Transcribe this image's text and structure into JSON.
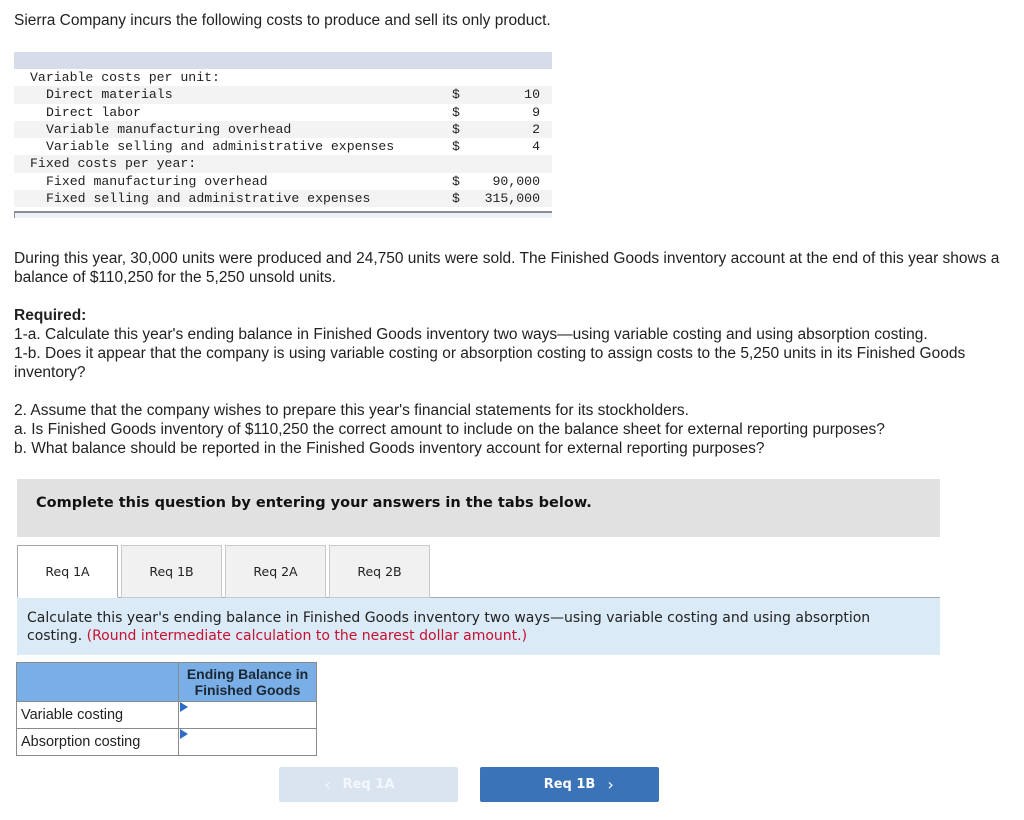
{
  "intro": "Sierra Company incurs the following costs to produce and sell its only product.",
  "cost_table": {
    "rows": [
      {
        "label": "Variable costs per unit:",
        "level": 0,
        "dollar": "",
        "amount": ""
      },
      {
        "label": "Direct materials",
        "level": 1,
        "dollar": "$",
        "amount": "10"
      },
      {
        "label": "Direct labor",
        "level": 1,
        "dollar": "$",
        "amount": "9"
      },
      {
        "label": "Variable manufacturing overhead",
        "level": 1,
        "dollar": "$",
        "amount": "2"
      },
      {
        "label": "Variable selling and administrative expenses",
        "level": 1,
        "dollar": "$",
        "amount": "4"
      },
      {
        "label": "Fixed costs per year:",
        "level": 0,
        "dollar": "",
        "amount": ""
      },
      {
        "label": "Fixed manufacturing overhead",
        "level": 1,
        "dollar": "$",
        "amount": "90,000"
      },
      {
        "label": "Fixed selling and administrative expenses",
        "level": 1,
        "dollar": "$",
        "amount": "315,000"
      }
    ]
  },
  "paragraph1": "During this year, 30,000 units were produced and 24,750 units were sold. The Finished Goods inventory account at the end of this year shows a balance of $110,250 for the 5,250 unsold units.",
  "required": {
    "heading": "Required:",
    "items": [
      "1-a. Calculate this year's ending balance in Finished Goods inventory two ways—using variable costing and using absorption costing.",
      "1-b. Does it appear that the company is using variable costing or absorption costing to assign costs to the 5,250 units in its Finished Goods inventory?"
    ]
  },
  "part2": [
    "2. Assume that the company wishes to prepare this year's financial statements for its stockholders.",
    "a. Is Finished Goods inventory of $110,250 the correct amount to include on the balance sheet for external reporting purposes?",
    "b. What balance should be reported in the Finished Goods inventory account for external reporting purposes?"
  ],
  "banner": "Complete this question by entering your answers in the tabs below.",
  "tabs": [
    {
      "label": "Req 1A",
      "active": true
    },
    {
      "label": "Req 1B",
      "active": false
    },
    {
      "label": "Req 2A",
      "active": false
    },
    {
      "label": "Req 2B",
      "active": false
    }
  ],
  "instruction": {
    "text": "Calculate this year's ending balance in Finished Goods inventory two ways—using variable costing and using absorption costing.",
    "note": "(Round intermediate calculation to the nearest dollar amount.)"
  },
  "answer_table": {
    "column_header": "Ending Balance in Finished Goods",
    "rows": [
      {
        "label": "Variable costing",
        "value": ""
      },
      {
        "label": "Absorption costing",
        "value": ""
      }
    ]
  },
  "nav": {
    "prev_label": "Req 1A",
    "next_label": "Req 1B",
    "prev_icon": "chevron-left-icon",
    "next_icon": "chevron-right-icon"
  },
  "colors": {
    "tab_banner": "#e1e1e1",
    "instruction_bg": "#daeaf7",
    "note_red": "#c8102e",
    "answer_header": "#7aaee6",
    "next_button": "#3a73b8",
    "prev_button_disabled": "#dae4f0"
  }
}
